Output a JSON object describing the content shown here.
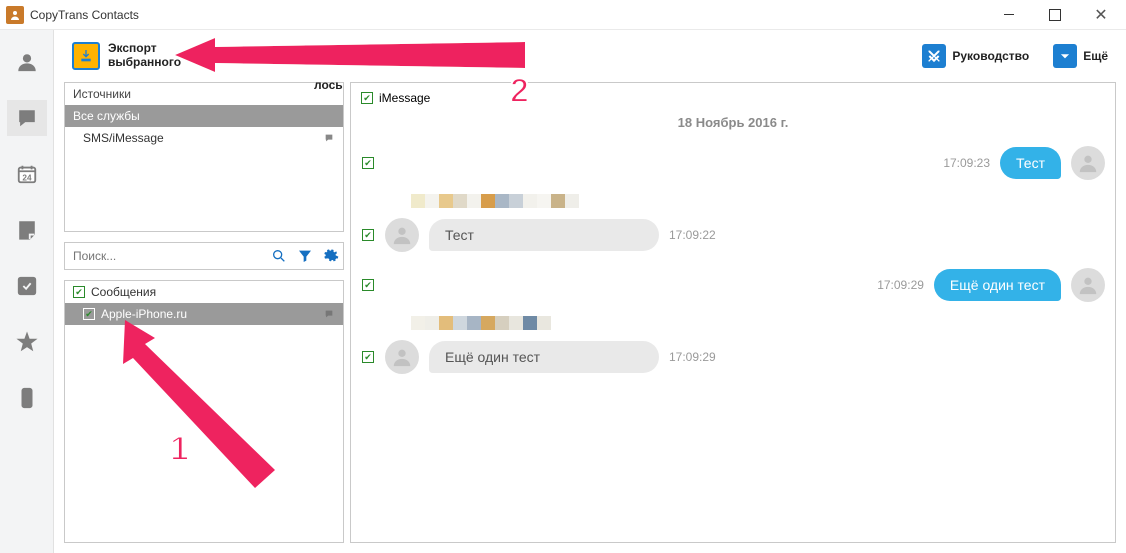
{
  "app": {
    "title": "CopyTrans Contacts"
  },
  "topbar": {
    "export_line1": "Экспорт",
    "export_line2": "выбранного",
    "hidden_fragment": "лось",
    "guide_label": "Руководство",
    "more_label": "Ещё"
  },
  "sources_panel": {
    "header": "Источники",
    "all_services": "Все службы",
    "sms_imessage": "SMS/iMessage"
  },
  "search": {
    "placeholder": "Поиск..."
  },
  "threads_panel": {
    "category": "Сообщения",
    "thread_name": "Apple-iPhone.ru"
  },
  "chat": {
    "source_label": "iMessage",
    "date": "18 Ноябрь 2016 г.",
    "messages": [
      {
        "dir": "out",
        "text": "Тест",
        "time": "17:09:23"
      },
      {
        "dir": "in",
        "text": "Тест",
        "time": "17:09:22"
      },
      {
        "dir": "out",
        "text": "Ещё один тест",
        "time": "17:09:29"
      },
      {
        "dir": "in",
        "text": "Ещё один тест",
        "time": "17:09:29"
      }
    ]
  },
  "annotations": {
    "label1": "1",
    "label2": "2"
  }
}
